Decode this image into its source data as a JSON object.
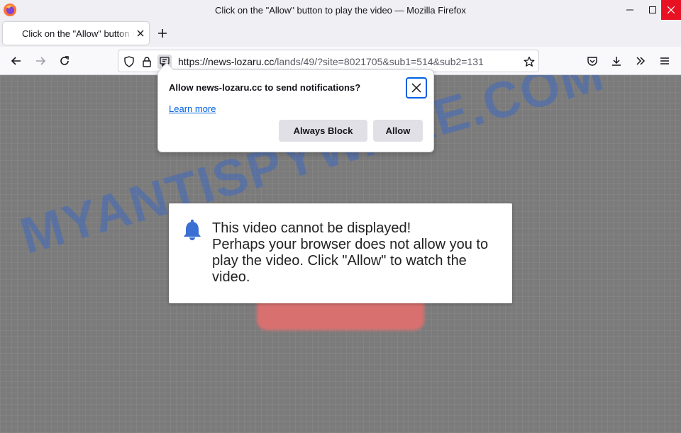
{
  "window": {
    "title": "Click on the \"Allow\" button to play the video — Mozilla Firefox"
  },
  "tab": {
    "title": "Click on the \"Allow\" button to play the video"
  },
  "url": {
    "host": "https://news-lozaru.cc",
    "path": "/lands/49/?site=8021705&sub1=514&sub2=131"
  },
  "notification": {
    "title": "Allow news-lozaru.cc to send notifications?",
    "learn_more": "Learn more",
    "block_label": "Always Block",
    "allow_label": "Allow"
  },
  "message": {
    "line1": "This video cannot be displayed!",
    "line2": "Perhaps your browser does not allow you to",
    "line3": "play the video. Click \"Allow\" to watch the",
    "line4": "video."
  },
  "watermark": "MYANTISPYWARE.COM",
  "colors": {
    "accent": "#0061e0",
    "bell": "#3b6fd4",
    "close": "#e81123"
  }
}
